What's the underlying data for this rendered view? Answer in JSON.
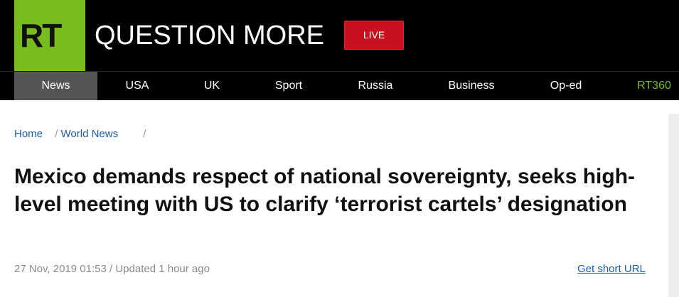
{
  "header": {
    "logo_text": "RT",
    "tagline": "QUESTION MORE",
    "live_label": "LIVE"
  },
  "nav": {
    "items": [
      {
        "label": "News",
        "active": true
      },
      {
        "label": "USA"
      },
      {
        "label": "UK"
      },
      {
        "label": "Sport"
      },
      {
        "label": "Russia"
      },
      {
        "label": "Business"
      },
      {
        "label": "Op-ed"
      },
      {
        "label": "RT360",
        "accent": true
      }
    ]
  },
  "breadcrumb": {
    "home": "Home",
    "separator": "/",
    "section": "World News"
  },
  "article": {
    "headline": "Mexico demands respect of national sovereignty, seeks high-level meeting with US to clarify ‘terrorist cartels’ designation",
    "date": "27 Nov, 2019 01:53",
    "updated": "/ Updated 1 hour ago",
    "short_url_label": "Get short URL"
  },
  "colors": {
    "brand_green": "#77bd1e",
    "live_red": "#c8101e",
    "link_blue": "#1a5fa8",
    "nav_active": "#555555"
  }
}
